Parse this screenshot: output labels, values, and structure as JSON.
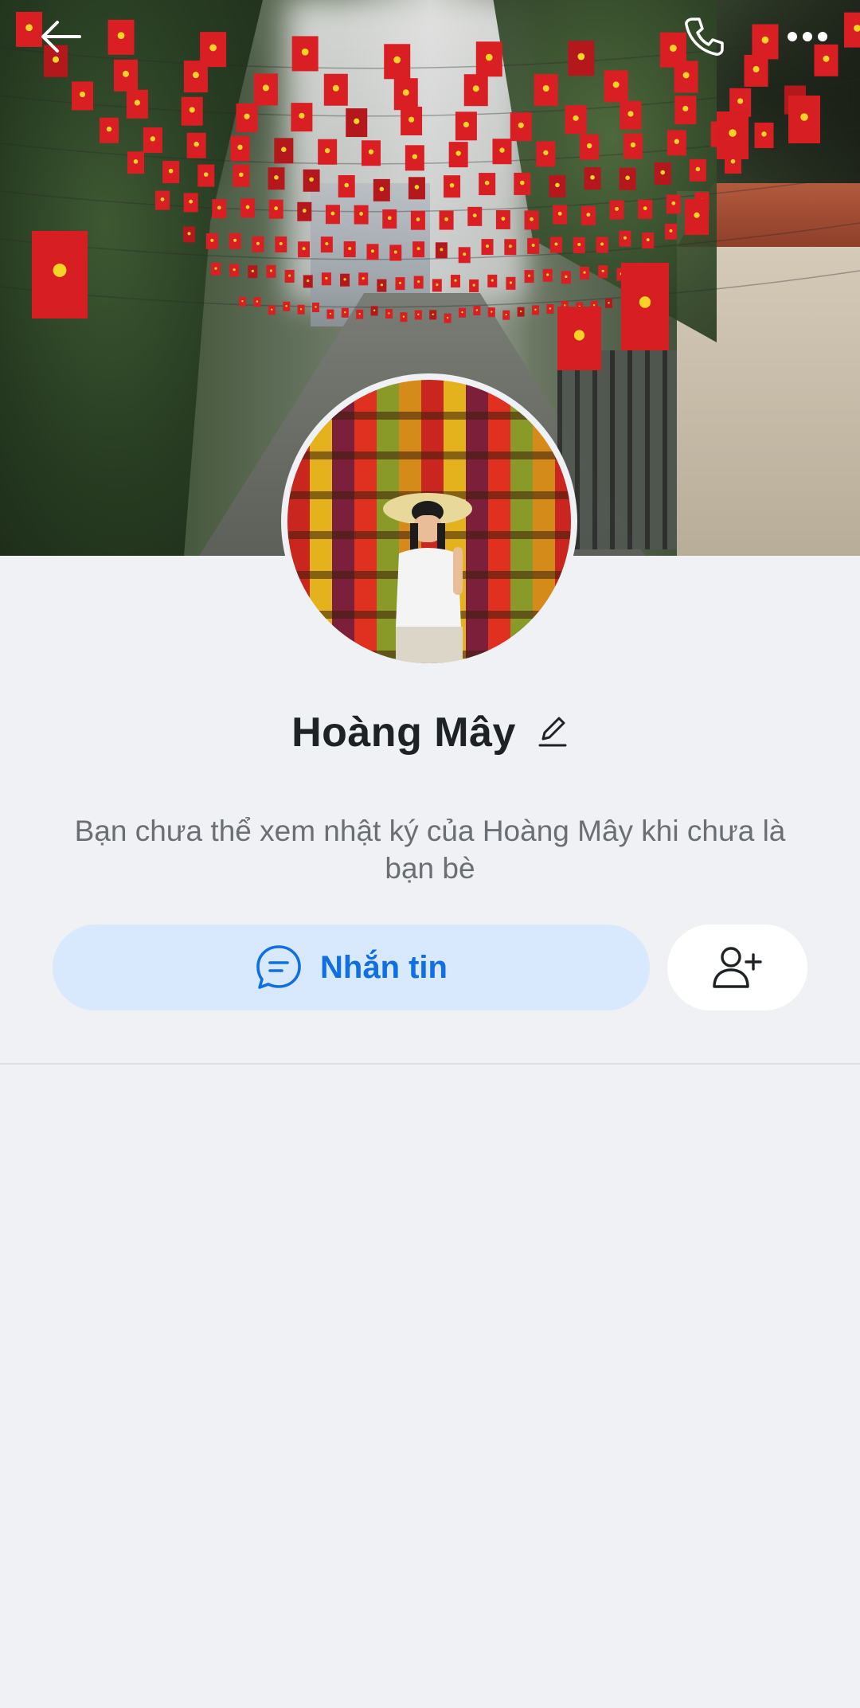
{
  "header": {
    "back_icon": "arrow-left-icon",
    "call_icon": "phone-icon",
    "more_icon": "more-horizontal-icon"
  },
  "profile": {
    "name": "Hoàng Mây",
    "edit_icon": "pencil-icon",
    "cover_description": "street lined with Vietnamese flags",
    "avatar_description": "woman in conical hat before incense bundles"
  },
  "notice": {
    "text": "Bạn chưa thể xem nhật ký của Hoàng Mây khi chưa là bạn bè"
  },
  "actions": {
    "message_label": "Nhắn tin",
    "message_icon": "chat-bubble-icon",
    "add_friend_icon": "add-friend-icon"
  },
  "colors": {
    "background": "#eff1f5",
    "accent": "#0f6fe3",
    "message_button_bg": "#d8e8fd",
    "name_text": "#1f2225",
    "muted_text": "#6b6f74"
  }
}
